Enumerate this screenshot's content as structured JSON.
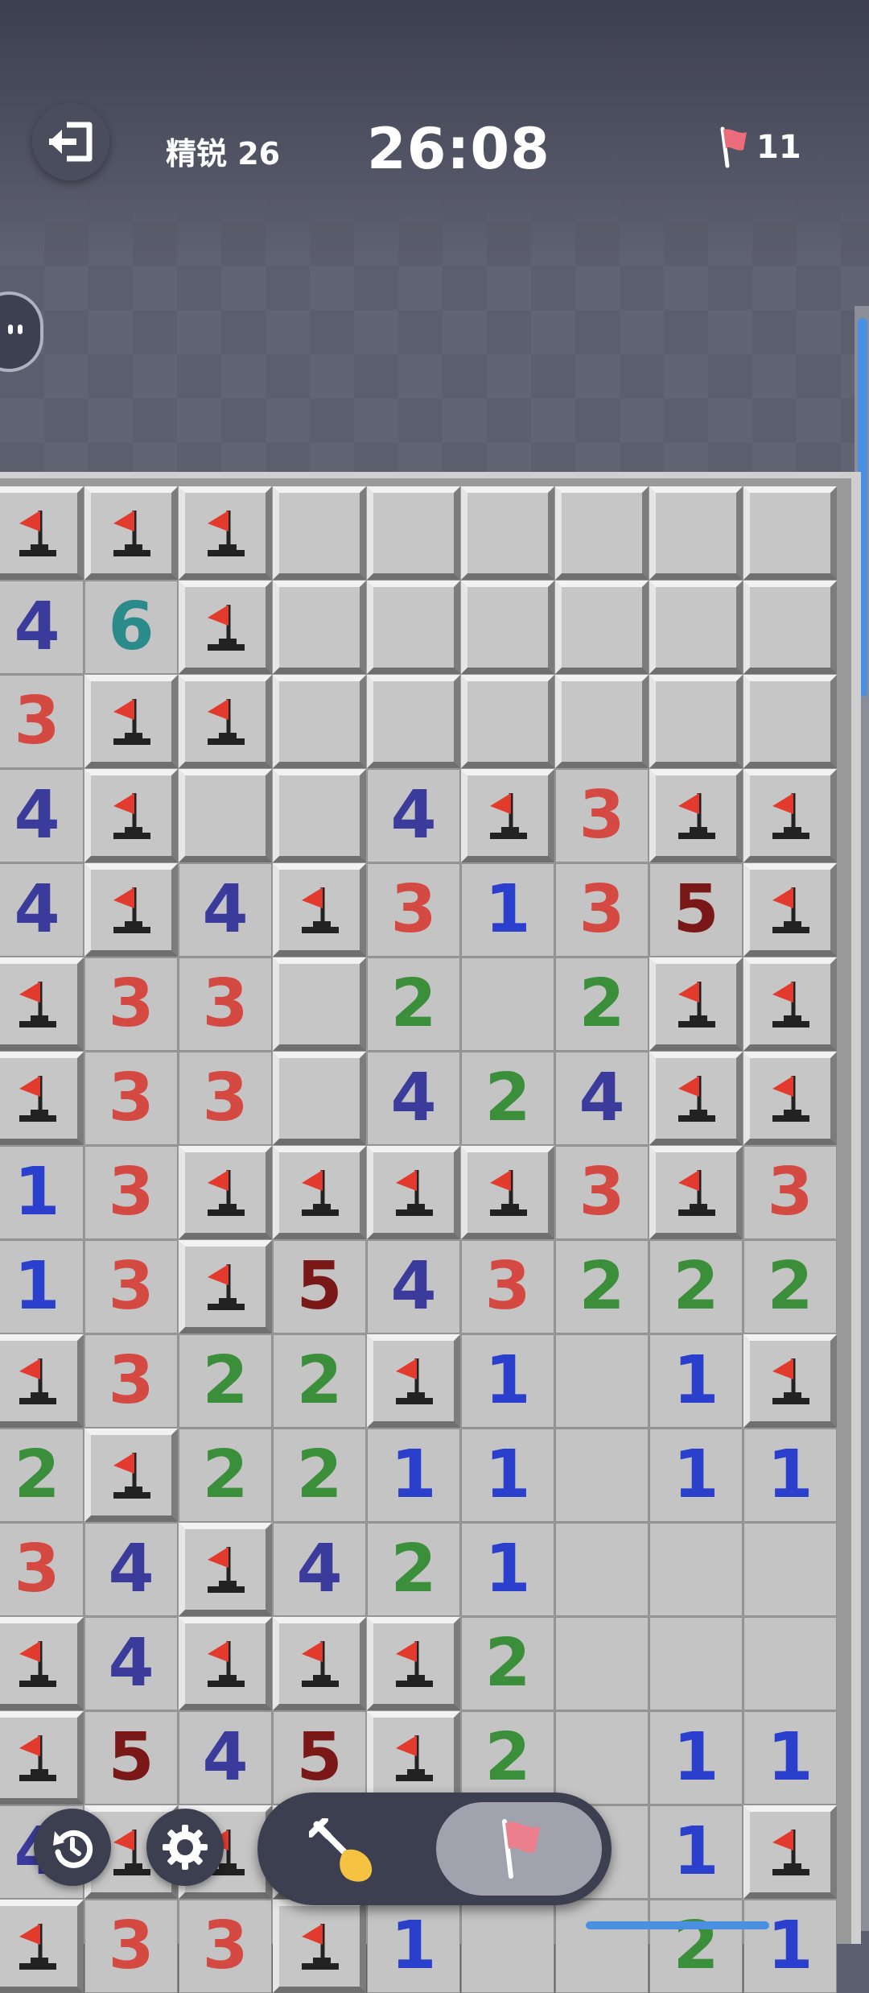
{
  "header": {
    "exit_icon": "exit-icon",
    "mode_label": "精锐 26",
    "timer": "26:08",
    "flag_icon": "flag-icon",
    "flags_remaining": "11"
  },
  "colors": {
    "1": "#2a3fcc",
    "2": "#3b8f3a",
    "3": "#d44a42",
    "4": "#3a3b9a",
    "5": "#7a1818",
    "6": "#2b8a8a"
  },
  "board": {
    "legend": "F = flagged cell, C = unopened cell, E = opened empty cell, digits = opened number",
    "rows": [
      [
        "F",
        "F",
        "F",
        "C",
        "C",
        "C",
        "C",
        "C",
        "C"
      ],
      [
        "4",
        "6",
        "F",
        "C",
        "C",
        "C",
        "C",
        "C",
        "C"
      ],
      [
        "3",
        "F",
        "F",
        "C",
        "C",
        "C",
        "C",
        "C",
        "C"
      ],
      [
        "4",
        "F",
        "C",
        "C",
        "4",
        "F",
        "3",
        "F",
        "F"
      ],
      [
        "4",
        "F",
        "4",
        "F",
        "3",
        "1",
        "3",
        "5",
        "F"
      ],
      [
        "F",
        "3",
        "3",
        "C",
        "2",
        "E",
        "2",
        "F",
        "F"
      ],
      [
        "F",
        "3",
        "3",
        "C",
        "4",
        "2",
        "4",
        "F",
        "F"
      ],
      [
        "1",
        "3",
        "F",
        "F",
        "F",
        "F",
        "3",
        "F",
        "3"
      ],
      [
        "1",
        "3",
        "F",
        "5",
        "4",
        "3",
        "2",
        "2",
        "2"
      ],
      [
        "F",
        "3",
        "2",
        "2",
        "F",
        "1",
        "E",
        "1",
        "F"
      ],
      [
        "2",
        "F",
        "2",
        "2",
        "1",
        "1",
        "E",
        "1",
        "1"
      ],
      [
        "3",
        "4",
        "F",
        "4",
        "2",
        "1",
        "E",
        "E",
        "E"
      ],
      [
        "F",
        "4",
        "F",
        "F",
        "F",
        "2",
        "E",
        "E",
        "E"
      ],
      [
        "F",
        "5",
        "4",
        "5",
        "F",
        "2",
        "E",
        "1",
        "1"
      ],
      [
        "4",
        "F",
        "F",
        "F",
        "E",
        "E",
        "E",
        "1",
        "F"
      ],
      [
        "F",
        "3",
        "3",
        "F",
        "1",
        "E",
        "E",
        "2",
        "1"
      ]
    ]
  },
  "controls": {
    "restart_icon": "restart-icon",
    "settings_icon": "gear-icon",
    "dig_tool_icon": "shovel-icon",
    "flag_tool_icon": "flag-icon",
    "side_icon": "chat-icon"
  }
}
